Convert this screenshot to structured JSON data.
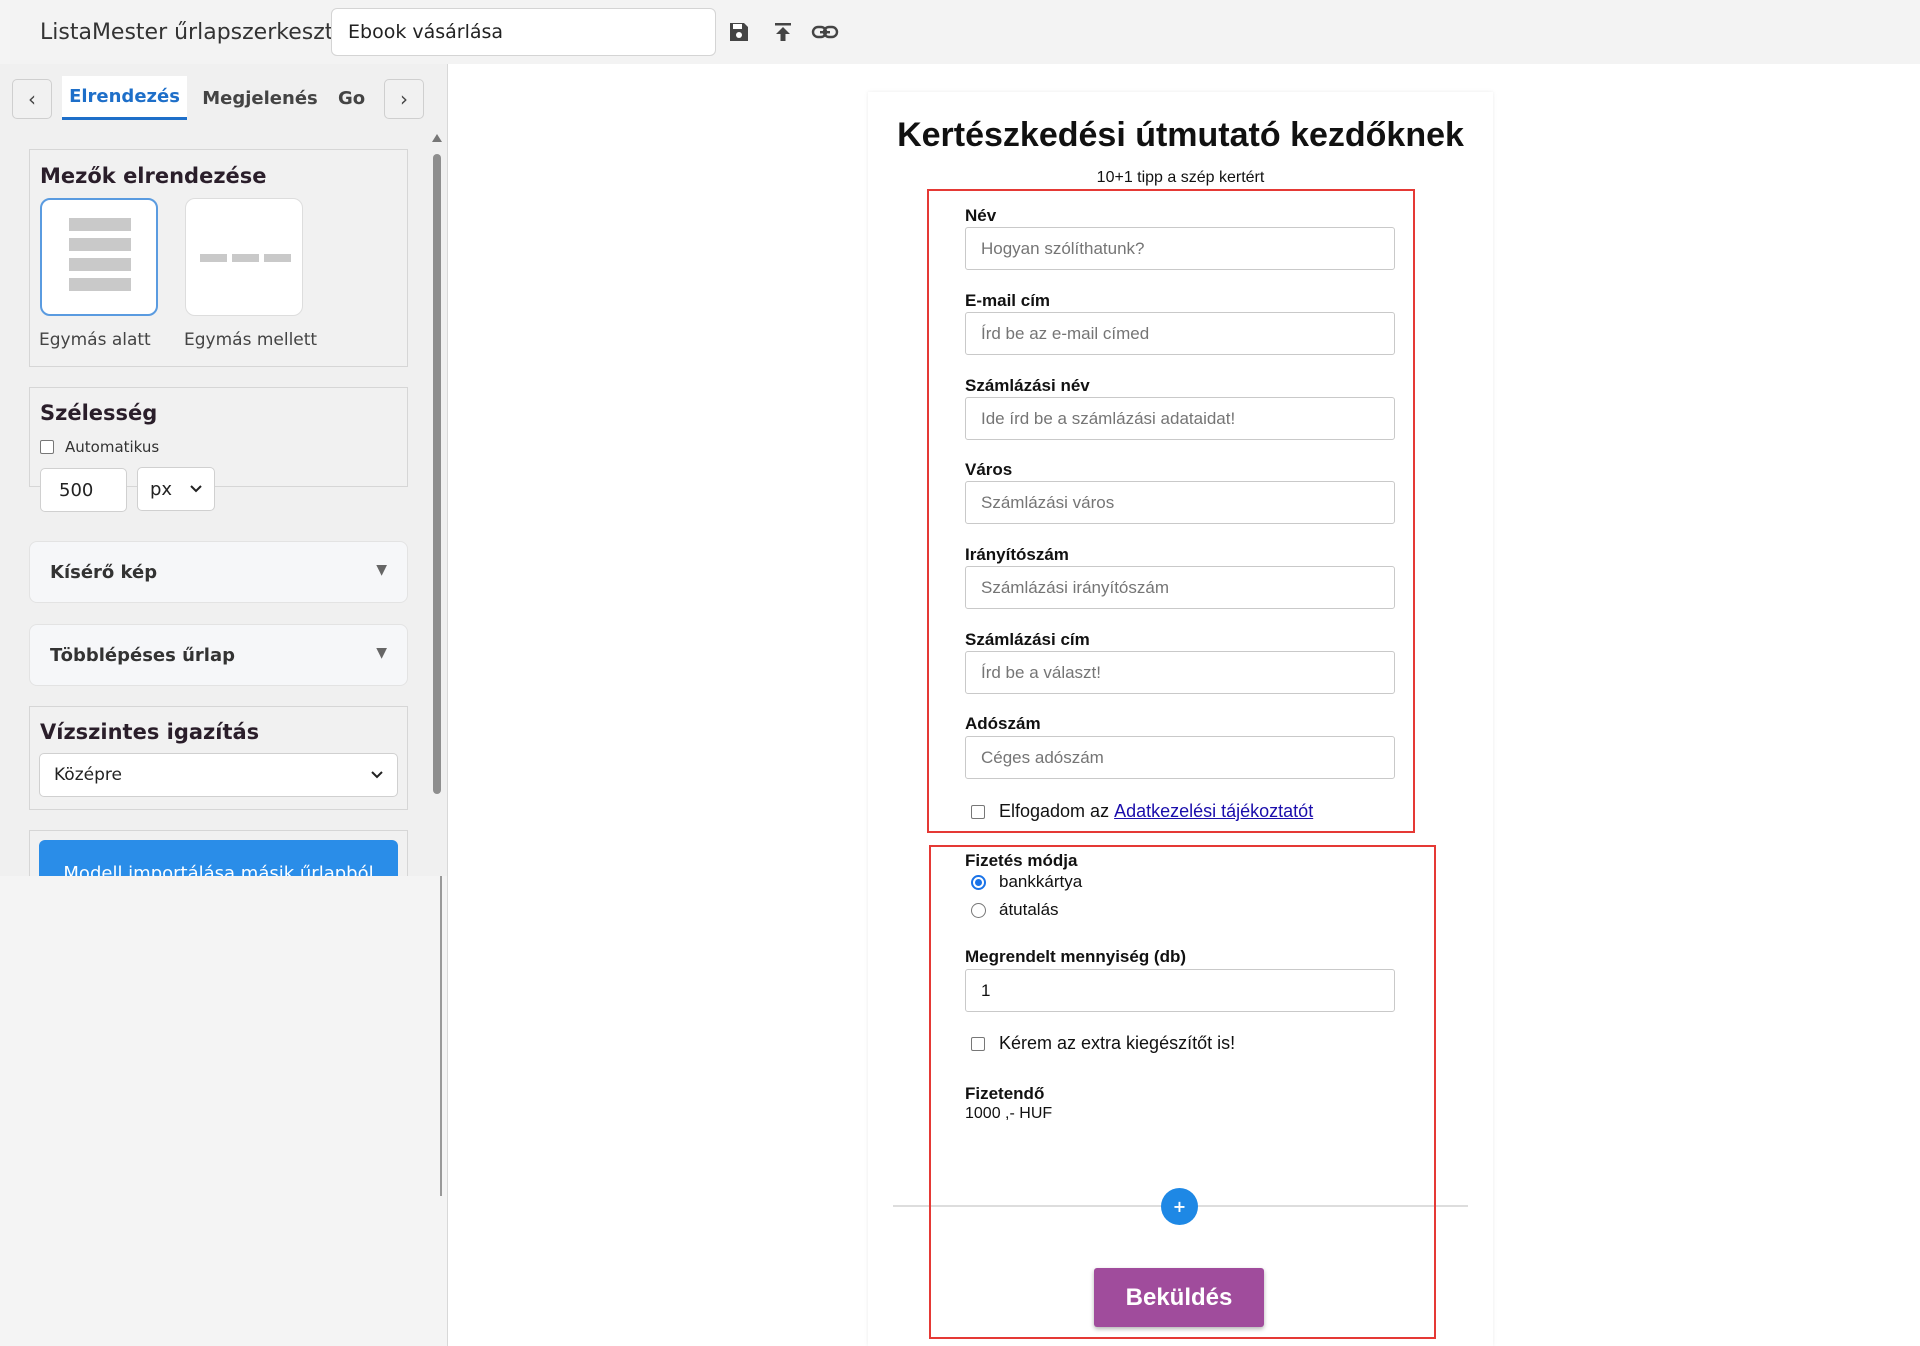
{
  "header": {
    "app_title": "ListaMester űrlapszerkesztő:",
    "form_name": "Ebook vásárlása",
    "icons": [
      "save-icon",
      "upload-icon",
      "link-icon"
    ]
  },
  "sidebar": {
    "tab_prev": "‹",
    "tab_next": "›",
    "tabs": [
      {
        "label": "Elrendezés",
        "active": true
      },
      {
        "label": "Megjelenés",
        "active": false
      },
      {
        "label": "Go",
        "active": false
      }
    ],
    "fields_layout": {
      "title": "Mezők elrendezése",
      "option_stacked": "Egymás alatt",
      "option_inline": "Egymás mellett",
      "selected": "Egymás alatt"
    },
    "width": {
      "title": "Szélesség",
      "auto_label": "Automatikus",
      "auto_checked": false,
      "value": "500",
      "unit": "px"
    },
    "accordion_image": "Kísérő kép",
    "accordion_multistep": "Többlépéses űrlap",
    "alignment": {
      "title": "Vízszintes igazítás",
      "selected": "Középre"
    },
    "import_button": "Modell importálása másik űrlapból"
  },
  "form": {
    "title": "Kertészkedési útmutató kezdőknek",
    "subtitle": "10+1 tipp a szép kertért",
    "fields": [
      {
        "label": "Név",
        "placeholder": "Hogyan szólíthatunk?"
      },
      {
        "label": "E-mail cím",
        "placeholder": "Írd be az e-mail címed"
      },
      {
        "label": "Számlázási név",
        "placeholder": "Ide írd be a számlázási adataidat!"
      },
      {
        "label": "Város",
        "placeholder": "Számlázási város"
      },
      {
        "label": "Irányítószám",
        "placeholder": "Számlázási irányítószám"
      },
      {
        "label": "Számlázási cím",
        "placeholder": "Írd be a választ!"
      },
      {
        "label": "Adószám",
        "placeholder": "Céges adószám"
      }
    ],
    "privacy_prefix": "Elfogadom az",
    "privacy_link": "Adatkezelési tájékoztatót",
    "payment": {
      "label": "Fizetés módja",
      "options": [
        {
          "label": "bankkártya",
          "checked": true
        },
        {
          "label": "átutalás",
          "checked": false
        }
      ]
    },
    "quantity": {
      "label": "Megrendelt mennyiség (db)",
      "value": "1"
    },
    "extra_label": "Kérem az extra kiegészítőt is!",
    "total_label": "Fizetendő",
    "total_value": "1000 ,- HUF",
    "add_button": "+",
    "submit": "Beküldés"
  },
  "colors": {
    "accent_blue": "#1e6fc9",
    "submit_purple": "#a04c9c",
    "highlight_red": "#e53935"
  }
}
